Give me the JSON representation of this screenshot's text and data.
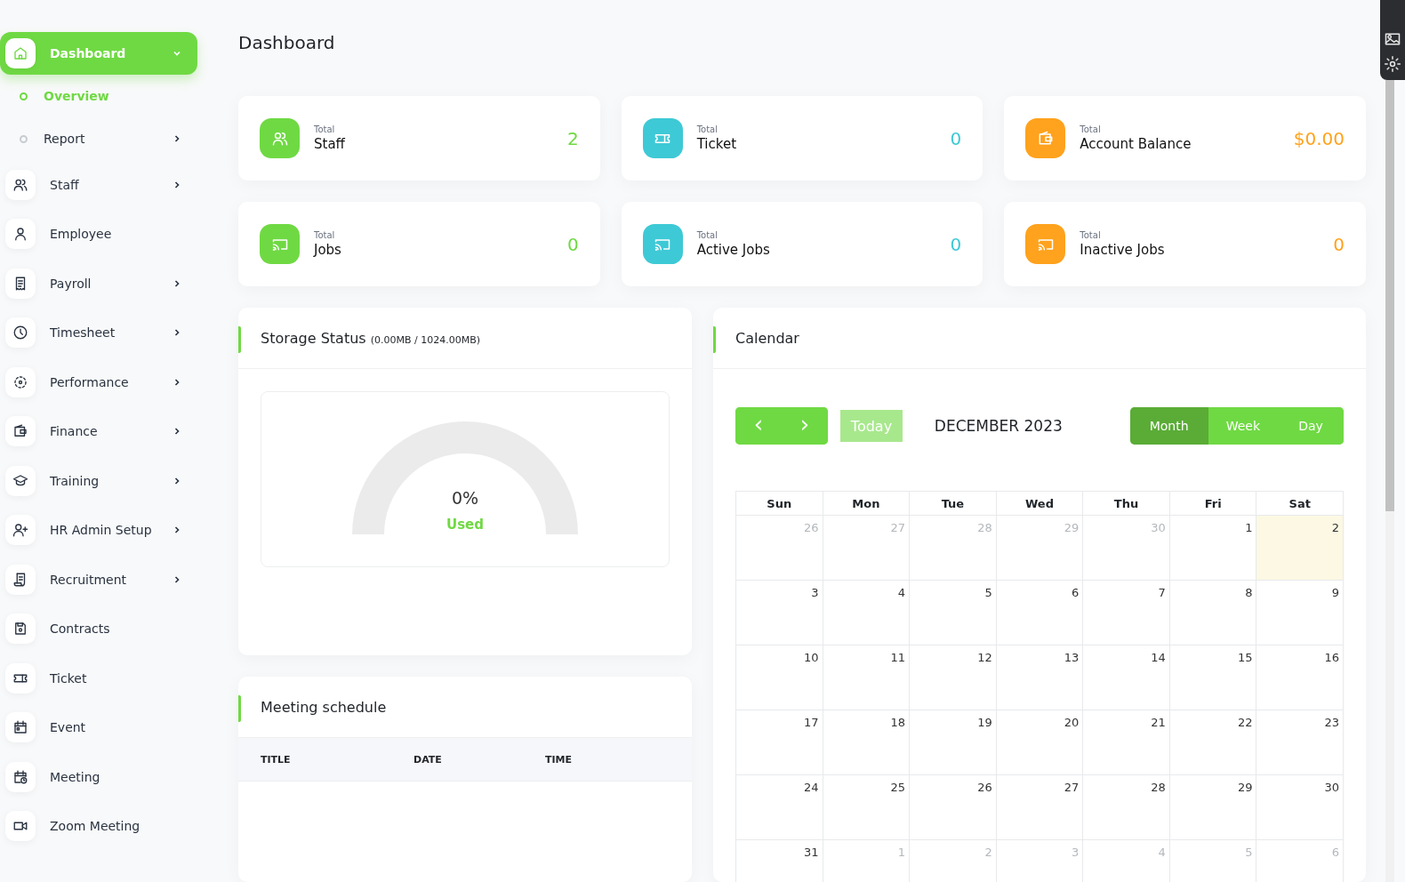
{
  "sidebar": {
    "items": [
      {
        "label": "Dashboard",
        "kind": "home",
        "selected": true,
        "has_submenu": true,
        "expanded": true,
        "children": [
          {
            "label": "Overview",
            "selected": true,
            "has_submenu": false
          },
          {
            "label": "Report",
            "selected": false,
            "has_submenu": true
          }
        ]
      },
      {
        "label": "Staff",
        "kind": "users",
        "selected": false,
        "has_submenu": true
      },
      {
        "label": "Employee",
        "kind": "user",
        "selected": false,
        "has_submenu": false
      },
      {
        "label": "Payroll",
        "kind": "receipt",
        "selected": false,
        "has_submenu": true
      },
      {
        "label": "Timesheet",
        "kind": "clock",
        "selected": false,
        "has_submenu": true
      },
      {
        "label": "Performance",
        "kind": "target",
        "selected": false,
        "has_submenu": true
      },
      {
        "label": "Finance",
        "kind": "wallet",
        "selected": false,
        "has_submenu": true
      },
      {
        "label": "Training",
        "kind": "cap",
        "selected": false,
        "has_submenu": true
      },
      {
        "label": "HR Admin Setup",
        "kind": "user-plus",
        "selected": false,
        "has_submenu": true
      },
      {
        "label": "Recruitment",
        "kind": "scroll",
        "selected": false,
        "has_submenu": true
      },
      {
        "label": "Contracts",
        "kind": "save",
        "selected": false,
        "has_submenu": false
      },
      {
        "label": "Ticket",
        "kind": "ticket",
        "selected": false,
        "has_submenu": false
      },
      {
        "label": "Event",
        "kind": "calendar",
        "selected": false,
        "has_submenu": false
      },
      {
        "label": "Meeting",
        "kind": "calendar-clock",
        "selected": false,
        "has_submenu": false
      },
      {
        "label": "Zoom Meeting",
        "kind": "video",
        "selected": false,
        "has_submenu": false
      }
    ]
  },
  "page_title": "Dashboard",
  "stats": [
    {
      "kind": "users",
      "caption": "Total",
      "label": "Staff",
      "value": "2",
      "color": "#6fd943"
    },
    {
      "kind": "ticket",
      "caption": "Total",
      "label": "Ticket",
      "value": "0",
      "color": "#3ec9d6"
    },
    {
      "kind": "wallet",
      "caption": "Total",
      "label": "Account Balance",
      "value": "$0.00",
      "color": "#ffa21d"
    },
    {
      "kind": "cast",
      "caption": "Total",
      "label": "Jobs",
      "value": "0",
      "color": "#6fd943"
    },
    {
      "kind": "cast",
      "caption": "Total",
      "label": "Active Jobs",
      "value": "0",
      "color": "#3ec9d6"
    },
    {
      "kind": "cast",
      "caption": "Total",
      "label": "Inactive Jobs",
      "value": "0",
      "color": "#ffa21d"
    }
  ],
  "storage": {
    "title": "Storage Status",
    "detail": "(0.00MB / 1024.00MB)",
    "percent": "0%",
    "caption": "Used"
  },
  "meetings": {
    "title": "Meeting schedule",
    "columns": [
      "TITLE",
      "DATE",
      "TIME"
    ]
  },
  "calendar": {
    "title": "Calendar",
    "prev": "‹",
    "next": "›",
    "today": {
      "label": "Today",
      "disabled": true
    },
    "month": "DECEMBER 2023",
    "views": [
      {
        "label": "Month",
        "selected": true
      },
      {
        "label": "Week",
        "selected": false
      },
      {
        "label": "Day",
        "selected": false
      }
    ],
    "weekdays": [
      "Sun",
      "Mon",
      "Tue",
      "Wed",
      "Thu",
      "Fri",
      "Sat"
    ],
    "weeks": [
      [
        {
          "day": "26",
          "other_month": true,
          "today": false
        },
        {
          "day": "27",
          "other_month": true,
          "today": false
        },
        {
          "day": "28",
          "other_month": true,
          "today": false
        },
        {
          "day": "29",
          "other_month": true,
          "today": false
        },
        {
          "day": "30",
          "other_month": true,
          "today": false
        },
        {
          "day": "1",
          "other_month": false,
          "today": false
        },
        {
          "day": "2",
          "other_month": false,
          "today": true
        }
      ],
      [
        {
          "day": "3",
          "other_month": false,
          "today": false
        },
        {
          "day": "4",
          "other_month": false,
          "today": false
        },
        {
          "day": "5",
          "other_month": false,
          "today": false
        },
        {
          "day": "6",
          "other_month": false,
          "today": false
        },
        {
          "day": "7",
          "other_month": false,
          "today": false
        },
        {
          "day": "8",
          "other_month": false,
          "today": false
        },
        {
          "day": "9",
          "other_month": false,
          "today": false
        }
      ],
      [
        {
          "day": "10",
          "other_month": false,
          "today": false
        },
        {
          "day": "11",
          "other_month": false,
          "today": false
        },
        {
          "day": "12",
          "other_month": false,
          "today": false
        },
        {
          "day": "13",
          "other_month": false,
          "today": false
        },
        {
          "day": "14",
          "other_month": false,
          "today": false
        },
        {
          "day": "15",
          "other_month": false,
          "today": false
        },
        {
          "day": "16",
          "other_month": false,
          "today": false
        }
      ],
      [
        {
          "day": "17",
          "other_month": false,
          "today": false
        },
        {
          "day": "18",
          "other_month": false,
          "today": false
        },
        {
          "day": "19",
          "other_month": false,
          "today": false
        },
        {
          "day": "20",
          "other_month": false,
          "today": false
        },
        {
          "day": "21",
          "other_month": false,
          "today": false
        },
        {
          "day": "22",
          "other_month": false,
          "today": false
        },
        {
          "day": "23",
          "other_month": false,
          "today": false
        }
      ],
      [
        {
          "day": "24",
          "other_month": false,
          "today": false
        },
        {
          "day": "25",
          "other_month": false,
          "today": false
        },
        {
          "day": "26",
          "other_month": false,
          "today": false
        },
        {
          "day": "27",
          "other_month": false,
          "today": false
        },
        {
          "day": "28",
          "other_month": false,
          "today": false
        },
        {
          "day": "29",
          "other_month": false,
          "today": false
        },
        {
          "day": "30",
          "other_month": false,
          "today": false
        }
      ],
      [
        {
          "day": "31",
          "other_month": false,
          "today": false
        },
        {
          "day": "1",
          "other_month": true,
          "today": false
        },
        {
          "day": "2",
          "other_month": true,
          "today": false
        },
        {
          "day": "3",
          "other_month": true,
          "today": false
        },
        {
          "day": "4",
          "other_month": true,
          "today": false
        },
        {
          "day": "5",
          "other_month": true,
          "today": false
        },
        {
          "day": "6",
          "other_month": true,
          "today": false
        }
      ]
    ]
  }
}
